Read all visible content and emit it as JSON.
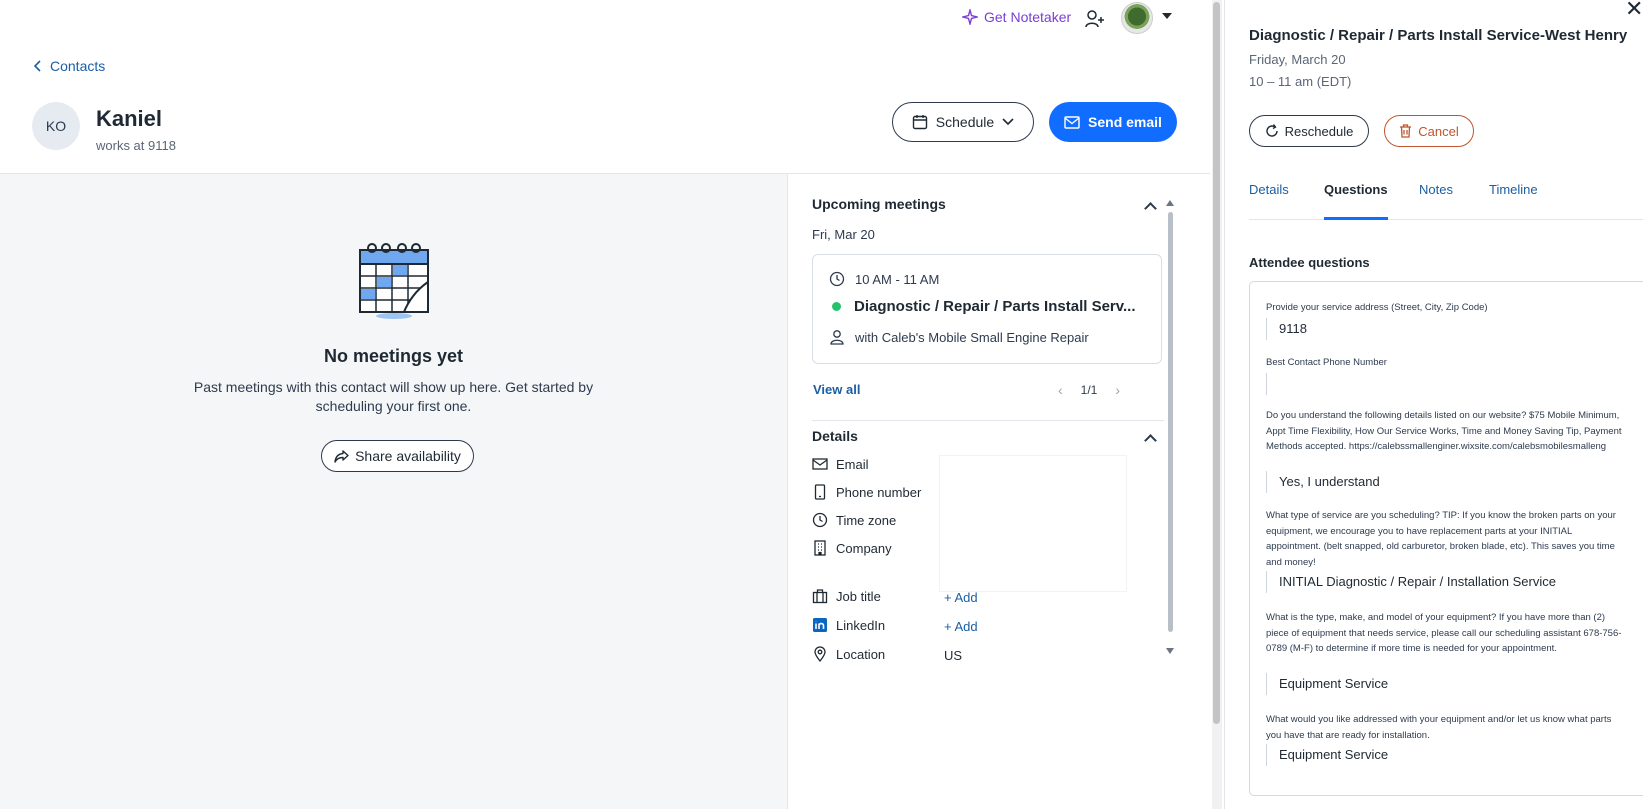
{
  "topbar": {
    "notetaker_label": "Get Notetaker",
    "icons": [
      "sparkle-icon",
      "add-person-icon",
      "caret-down-icon"
    ]
  },
  "header": {
    "back_label": "Contacts",
    "avatar_initials": "KO",
    "name": "Kaniel",
    "subtitle": "works at 9118",
    "schedule_label": "Schedule",
    "send_email_label": "Send email"
  },
  "empty_state": {
    "title": "No meetings yet",
    "description": "Past meetings with this contact will show up here. Get started by scheduling your first one.",
    "share_label": "Share availability"
  },
  "upcoming": {
    "title": "Upcoming meetings",
    "date": "Fri, Mar 20",
    "meeting": {
      "time": "10 AM - 11 AM",
      "title": "Diagnostic / Repair / Parts Install Serv...",
      "with": "with Caleb's Mobile Small Engine Repair"
    },
    "view_all": "View all",
    "pager": "1/1"
  },
  "details": {
    "title": "Details",
    "fields": {
      "email": "Email",
      "phone": "Phone number",
      "timezone": "Time zone",
      "company": "Company",
      "job_title": "Job title",
      "linkedin": "LinkedIn",
      "location": "Location"
    },
    "add_label": "+ Add",
    "location_value": "US"
  },
  "panel": {
    "title": "Diagnostic / Repair / Parts Install Service-West Henry",
    "date": "Friday, March 20",
    "time": "10 – 11 am (EDT)",
    "reschedule_label": "Reschedule",
    "cancel_label": "Cancel",
    "tabs": [
      "Details",
      "Questions",
      "Notes",
      "Timeline"
    ],
    "active_tab": "Questions",
    "attendee_title": "Attendee questions",
    "questions": [
      {
        "q": "Provide your service address (Street, City, Zip Code)",
        "a": "9118"
      },
      {
        "q": "Best Contact Phone Number",
        "a": ""
      },
      {
        "q": "Do you understand the following details listed on our website? $75 Mobile Minimum, Appt Time Flexibility, How Our Service Works, Time and Money Saving Tip, Payment Methods accepted. https://calebssmallenginer.wixsite.com/calebsmobilesmalleng",
        "a": "Yes, I understand"
      },
      {
        "q": "What type of service are you scheduling? TIP: If you know the broken parts on your equipment, we encourage you to have replacement parts at your INITIAL appointment. (belt snapped, old carburetor, broken blade, etc). This saves you time and money!",
        "a": "INITIAL Diagnostic / Repair / Installation Service"
      },
      {
        "q": "What is the type, make, and model of your equipment? If you have more than (2) piece of equipment that needs service, please call our scheduling assistant 678-756-0789 (M-F) to determine if more time is needed for your appointment.",
        "a": "Equipment Service"
      },
      {
        "q": "What would you like addressed with your equipment and/or let us know what parts you have that are ready for installation.",
        "a": "Equipment Service"
      }
    ]
  },
  "colors": {
    "accent": "#116dff",
    "link": "#1b5fa3",
    "notetaker": "#7b3fd1",
    "cancel": "#c0542c",
    "status_dot": "#25c26e"
  }
}
